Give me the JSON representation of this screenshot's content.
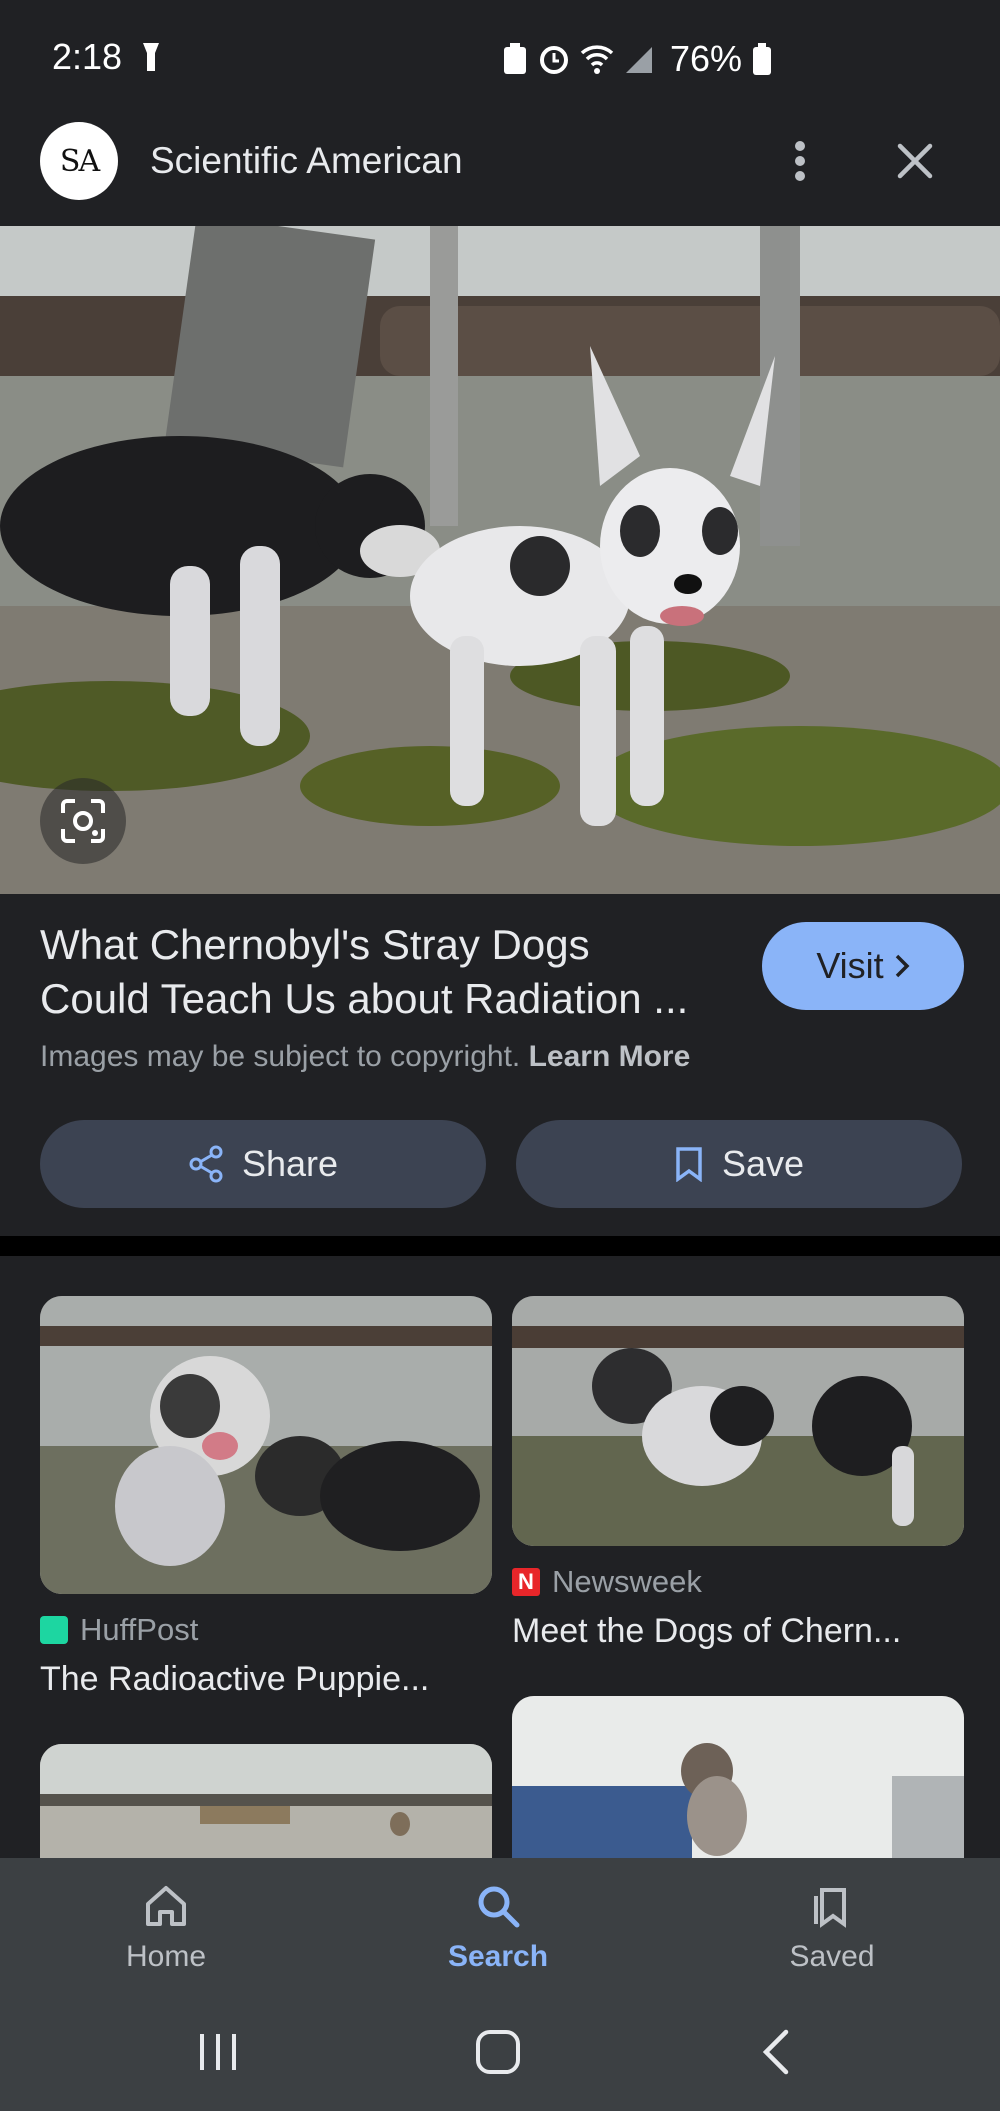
{
  "status_bar": {
    "time": "2:18",
    "battery": "76%"
  },
  "header": {
    "logo_text": "SA",
    "source": "Scientific American"
  },
  "result": {
    "title_line1": "What Chernobyl's Stray Dogs",
    "title_line2": "Could Teach Us about Radiation ...",
    "visit_label": "Visit",
    "copyright_text": "Images may be subject to copyright.",
    "learn_more": "Learn More",
    "share_label": "Share",
    "save_label": "Save"
  },
  "related": [
    {
      "source": "HuffPost",
      "title": "The Radioactive Puppie...",
      "source_color": "#1dd6a1"
    },
    {
      "source": "Newsweek",
      "title": "Meet the Dogs of Chern...",
      "source_color": "#e8262a",
      "source_letter": "N"
    }
  ],
  "bottom_nav": {
    "home": "Home",
    "search": "Search",
    "saved": "Saved"
  },
  "colors": {
    "accent": "#8ab4f8",
    "background": "#202124"
  }
}
